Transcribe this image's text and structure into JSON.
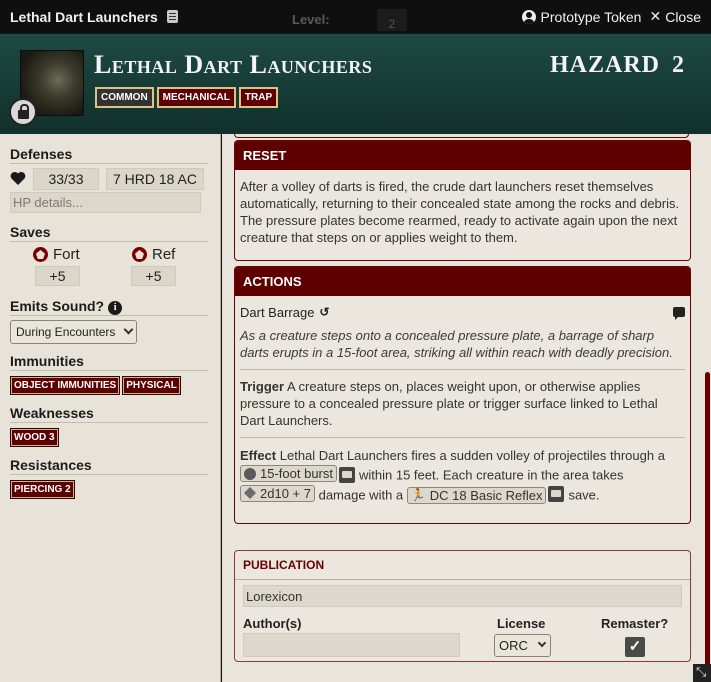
{
  "window": {
    "title": "Lethal Dart Launchers",
    "ghost_level_label": "Level:",
    "ghost_level_value": "2",
    "prototype_label": "Prototype Token",
    "close_label": "Close"
  },
  "header": {
    "name": "Lethal Dart Launchers",
    "traits": [
      "Common",
      "Mechanical",
      "Trap"
    ],
    "type_label": "HAZARD",
    "level": "2"
  },
  "sidebar": {
    "defenses_label": "Defenses",
    "hp": "33/33",
    "hardness_ac": "7 HRD 18 AC",
    "hp_details_placeholder": "HP details...",
    "saves_label": "Saves",
    "fort_label": "Fort",
    "fort_value": "+5",
    "ref_label": "Ref",
    "ref_value": "+5",
    "emits_sound_label": "Emits Sound?",
    "emits_sound_value": "During Encounters",
    "immunities_label": "Immunities",
    "immunities": [
      "Object Immunities",
      "Physical"
    ],
    "weaknesses_label": "Weaknesses",
    "weaknesses": [
      "Wood 3"
    ],
    "resistances_label": "Resistances",
    "resistances": [
      "Piercing 2"
    ]
  },
  "reset": {
    "heading": "RESET",
    "text": "After a volley of darts is fired, the crude dart launchers reset themselves automatically, returning to their concealed state among the rocks and debris. The pressure plates become rearmed, ready to activate again upon the next creature that steps on or applies weight to them."
  },
  "actions": {
    "heading": "ACTIONS",
    "action_name": "Dart Barrage",
    "action_glyph": "↺",
    "flavor": "As a creature steps onto a concealed pressure plate, a barrage of sharp darts erupts in a 15-foot area, striking all within reach with deadly precision.",
    "trigger_label": "Trigger",
    "trigger_text": "A creature steps on, places weight upon, or otherwise applies pressure to a concealed pressure plate or trigger surface linked to Lethal Dart Launchers.",
    "effect_label": "Effect",
    "effect_text_1": "Lethal Dart Launchers fires a sudden volley of projectiles through a",
    "area_label": "15-foot burst",
    "effect_text_2": "within 15 feet. Each creature in the area takes",
    "damage_label": "2d10 + 7",
    "effect_text_3": "damage with a",
    "save_label": "DC 18 Basic Reflex",
    "effect_text_4": "save."
  },
  "publication": {
    "heading": "PUBLICATION",
    "source": "Lorexicon",
    "authors_label": "Author(s)",
    "license_label": "License",
    "license_value": "ORC",
    "remaster_label": "Remaster?",
    "remaster_checked": "✓"
  },
  "colors": {
    "header_bg": "#1f4a44",
    "accent_red": "#5e0000",
    "panel_bg": "#ebe7de"
  }
}
